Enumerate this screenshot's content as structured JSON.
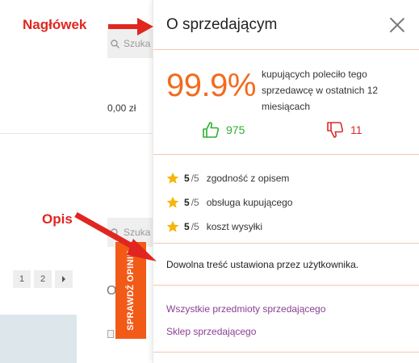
{
  "background": {
    "search_placeholder": "Szuka",
    "price": "0,00 zł",
    "pages": [
      "1",
      "2"
    ],
    "letter": "O"
  },
  "tab": {
    "label": "SPRAWDŹ OPINIE"
  },
  "panel": {
    "title": "O sprzedającym",
    "percent": "99.9%",
    "percent_text": "kupujących poleciło tego sprzedawcę w ostatnich 12 miesiącach",
    "positive_count": "975",
    "negative_count": "11",
    "criteria": [
      {
        "score": "5",
        "of": "/5",
        "label": "zgodność z opisem"
      },
      {
        "score": "5",
        "of": "/5",
        "label": "obsługa kupującego"
      },
      {
        "score": "5",
        "of": "/5",
        "label": "koszt wysyłki"
      }
    ],
    "description": "Dowolna treść ustawiona przez użytkownika.",
    "links": [
      "Wszystkie przedmioty sprzedającego",
      "Sklep sprzedającego"
    ]
  },
  "annotations": {
    "header": "Nagłówek",
    "description": "Opis"
  },
  "colors": {
    "accent": "#f26b1d",
    "positive": "#2db02d",
    "negative": "#d92b2b",
    "link": "#8a3f93",
    "annotation": "#e0261f"
  }
}
